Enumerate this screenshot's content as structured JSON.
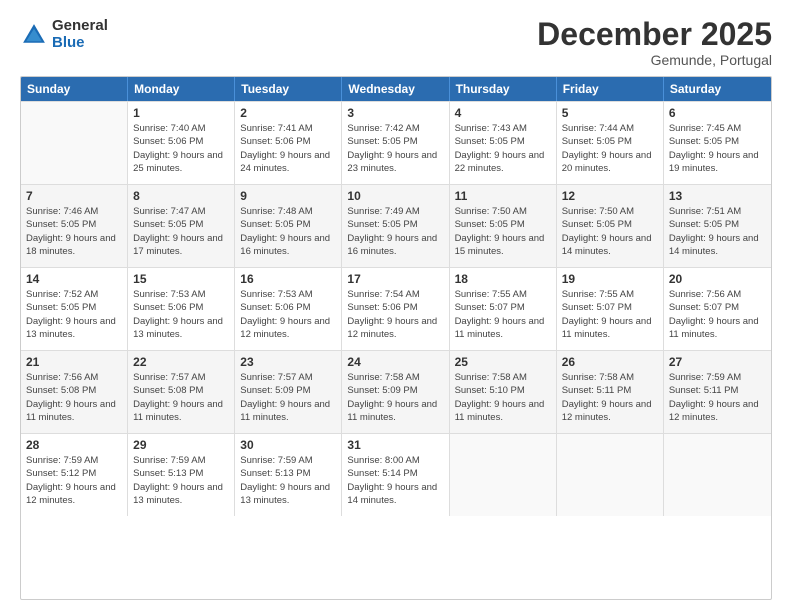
{
  "logo": {
    "general": "General",
    "blue": "Blue"
  },
  "header": {
    "month_title": "December 2025",
    "location": "Gemunde, Portugal"
  },
  "weekdays": [
    "Sunday",
    "Monday",
    "Tuesday",
    "Wednesday",
    "Thursday",
    "Friday",
    "Saturday"
  ],
  "weeks": [
    [
      {
        "day": "",
        "sunrise": "",
        "sunset": "",
        "daylight": ""
      },
      {
        "day": "1",
        "sunrise": "Sunrise: 7:40 AM",
        "sunset": "Sunset: 5:06 PM",
        "daylight": "Daylight: 9 hours and 25 minutes."
      },
      {
        "day": "2",
        "sunrise": "Sunrise: 7:41 AM",
        "sunset": "Sunset: 5:06 PM",
        "daylight": "Daylight: 9 hours and 24 minutes."
      },
      {
        "day": "3",
        "sunrise": "Sunrise: 7:42 AM",
        "sunset": "Sunset: 5:05 PM",
        "daylight": "Daylight: 9 hours and 23 minutes."
      },
      {
        "day": "4",
        "sunrise": "Sunrise: 7:43 AM",
        "sunset": "Sunset: 5:05 PM",
        "daylight": "Daylight: 9 hours and 22 minutes."
      },
      {
        "day": "5",
        "sunrise": "Sunrise: 7:44 AM",
        "sunset": "Sunset: 5:05 PM",
        "daylight": "Daylight: 9 hours and 20 minutes."
      },
      {
        "day": "6",
        "sunrise": "Sunrise: 7:45 AM",
        "sunset": "Sunset: 5:05 PM",
        "daylight": "Daylight: 9 hours and 19 minutes."
      }
    ],
    [
      {
        "day": "7",
        "sunrise": "Sunrise: 7:46 AM",
        "sunset": "Sunset: 5:05 PM",
        "daylight": "Daylight: 9 hours and 18 minutes."
      },
      {
        "day": "8",
        "sunrise": "Sunrise: 7:47 AM",
        "sunset": "Sunset: 5:05 PM",
        "daylight": "Daylight: 9 hours and 17 minutes."
      },
      {
        "day": "9",
        "sunrise": "Sunrise: 7:48 AM",
        "sunset": "Sunset: 5:05 PM",
        "daylight": "Daylight: 9 hours and 16 minutes."
      },
      {
        "day": "10",
        "sunrise": "Sunrise: 7:49 AM",
        "sunset": "Sunset: 5:05 PM",
        "daylight": "Daylight: 9 hours and 16 minutes."
      },
      {
        "day": "11",
        "sunrise": "Sunrise: 7:50 AM",
        "sunset": "Sunset: 5:05 PM",
        "daylight": "Daylight: 9 hours and 15 minutes."
      },
      {
        "day": "12",
        "sunrise": "Sunrise: 7:50 AM",
        "sunset": "Sunset: 5:05 PM",
        "daylight": "Daylight: 9 hours and 14 minutes."
      },
      {
        "day": "13",
        "sunrise": "Sunrise: 7:51 AM",
        "sunset": "Sunset: 5:05 PM",
        "daylight": "Daylight: 9 hours and 14 minutes."
      }
    ],
    [
      {
        "day": "14",
        "sunrise": "Sunrise: 7:52 AM",
        "sunset": "Sunset: 5:05 PM",
        "daylight": "Daylight: 9 hours and 13 minutes."
      },
      {
        "day": "15",
        "sunrise": "Sunrise: 7:53 AM",
        "sunset": "Sunset: 5:06 PM",
        "daylight": "Daylight: 9 hours and 13 minutes."
      },
      {
        "day": "16",
        "sunrise": "Sunrise: 7:53 AM",
        "sunset": "Sunset: 5:06 PM",
        "daylight": "Daylight: 9 hours and 12 minutes."
      },
      {
        "day": "17",
        "sunrise": "Sunrise: 7:54 AM",
        "sunset": "Sunset: 5:06 PM",
        "daylight": "Daylight: 9 hours and 12 minutes."
      },
      {
        "day": "18",
        "sunrise": "Sunrise: 7:55 AM",
        "sunset": "Sunset: 5:07 PM",
        "daylight": "Daylight: 9 hours and 11 minutes."
      },
      {
        "day": "19",
        "sunrise": "Sunrise: 7:55 AM",
        "sunset": "Sunset: 5:07 PM",
        "daylight": "Daylight: 9 hours and 11 minutes."
      },
      {
        "day": "20",
        "sunrise": "Sunrise: 7:56 AM",
        "sunset": "Sunset: 5:07 PM",
        "daylight": "Daylight: 9 hours and 11 minutes."
      }
    ],
    [
      {
        "day": "21",
        "sunrise": "Sunrise: 7:56 AM",
        "sunset": "Sunset: 5:08 PM",
        "daylight": "Daylight: 9 hours and 11 minutes."
      },
      {
        "day": "22",
        "sunrise": "Sunrise: 7:57 AM",
        "sunset": "Sunset: 5:08 PM",
        "daylight": "Daylight: 9 hours and 11 minutes."
      },
      {
        "day": "23",
        "sunrise": "Sunrise: 7:57 AM",
        "sunset": "Sunset: 5:09 PM",
        "daylight": "Daylight: 9 hours and 11 minutes."
      },
      {
        "day": "24",
        "sunrise": "Sunrise: 7:58 AM",
        "sunset": "Sunset: 5:09 PM",
        "daylight": "Daylight: 9 hours and 11 minutes."
      },
      {
        "day": "25",
        "sunrise": "Sunrise: 7:58 AM",
        "sunset": "Sunset: 5:10 PM",
        "daylight": "Daylight: 9 hours and 11 minutes."
      },
      {
        "day": "26",
        "sunrise": "Sunrise: 7:58 AM",
        "sunset": "Sunset: 5:11 PM",
        "daylight": "Daylight: 9 hours and 12 minutes."
      },
      {
        "day": "27",
        "sunrise": "Sunrise: 7:59 AM",
        "sunset": "Sunset: 5:11 PM",
        "daylight": "Daylight: 9 hours and 12 minutes."
      }
    ],
    [
      {
        "day": "28",
        "sunrise": "Sunrise: 7:59 AM",
        "sunset": "Sunset: 5:12 PM",
        "daylight": "Daylight: 9 hours and 12 minutes."
      },
      {
        "day": "29",
        "sunrise": "Sunrise: 7:59 AM",
        "sunset": "Sunset: 5:13 PM",
        "daylight": "Daylight: 9 hours and 13 minutes."
      },
      {
        "day": "30",
        "sunrise": "Sunrise: 7:59 AM",
        "sunset": "Sunset: 5:13 PM",
        "daylight": "Daylight: 9 hours and 13 minutes."
      },
      {
        "day": "31",
        "sunrise": "Sunrise: 8:00 AM",
        "sunset": "Sunset: 5:14 PM",
        "daylight": "Daylight: 9 hours and 14 minutes."
      },
      {
        "day": "",
        "sunrise": "",
        "sunset": "",
        "daylight": ""
      },
      {
        "day": "",
        "sunrise": "",
        "sunset": "",
        "daylight": ""
      },
      {
        "day": "",
        "sunrise": "",
        "sunset": "",
        "daylight": ""
      }
    ]
  ]
}
